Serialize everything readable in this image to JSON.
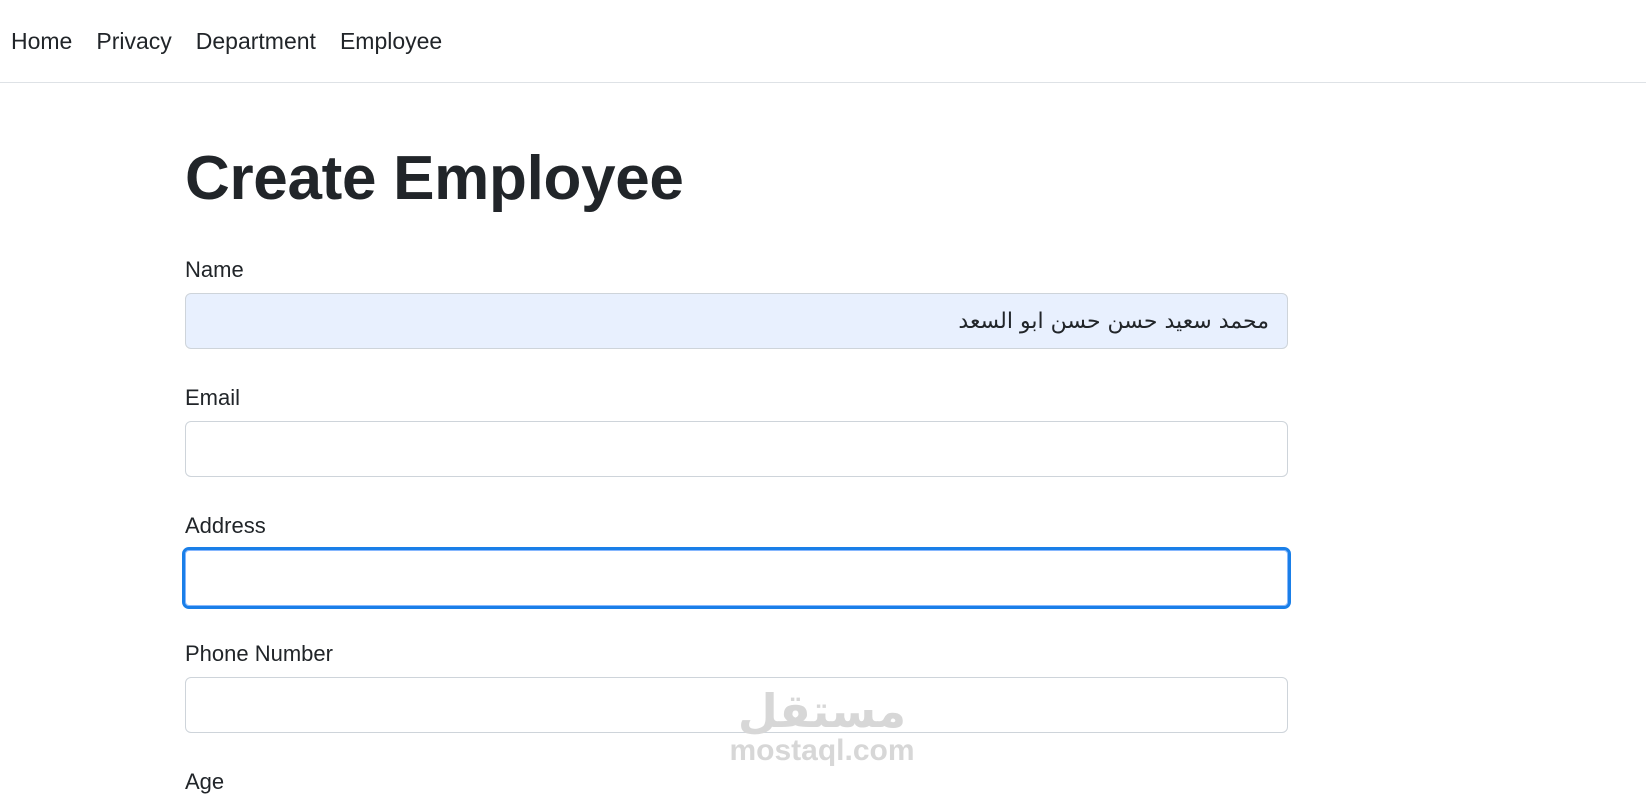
{
  "nav": {
    "items": [
      {
        "label": "Home"
      },
      {
        "label": "Privacy"
      },
      {
        "label": "Department"
      },
      {
        "label": "Employee"
      }
    ]
  },
  "page": {
    "title": "Create Employee"
  },
  "form": {
    "name": {
      "label": "Name",
      "value": "محمد سعيد حسن حسن ابو السعد"
    },
    "email": {
      "label": "Email",
      "value": ""
    },
    "address": {
      "label": "Address",
      "value": ""
    },
    "phone": {
      "label": "Phone Number",
      "value": ""
    },
    "age": {
      "label": "Age"
    }
  },
  "watermark": {
    "arabic": "مستقل",
    "latin": "mostaql.com"
  },
  "colors": {
    "focus_border": "#1a7fe8",
    "autofill_background": "#e8f0fe",
    "text": "#212529"
  }
}
